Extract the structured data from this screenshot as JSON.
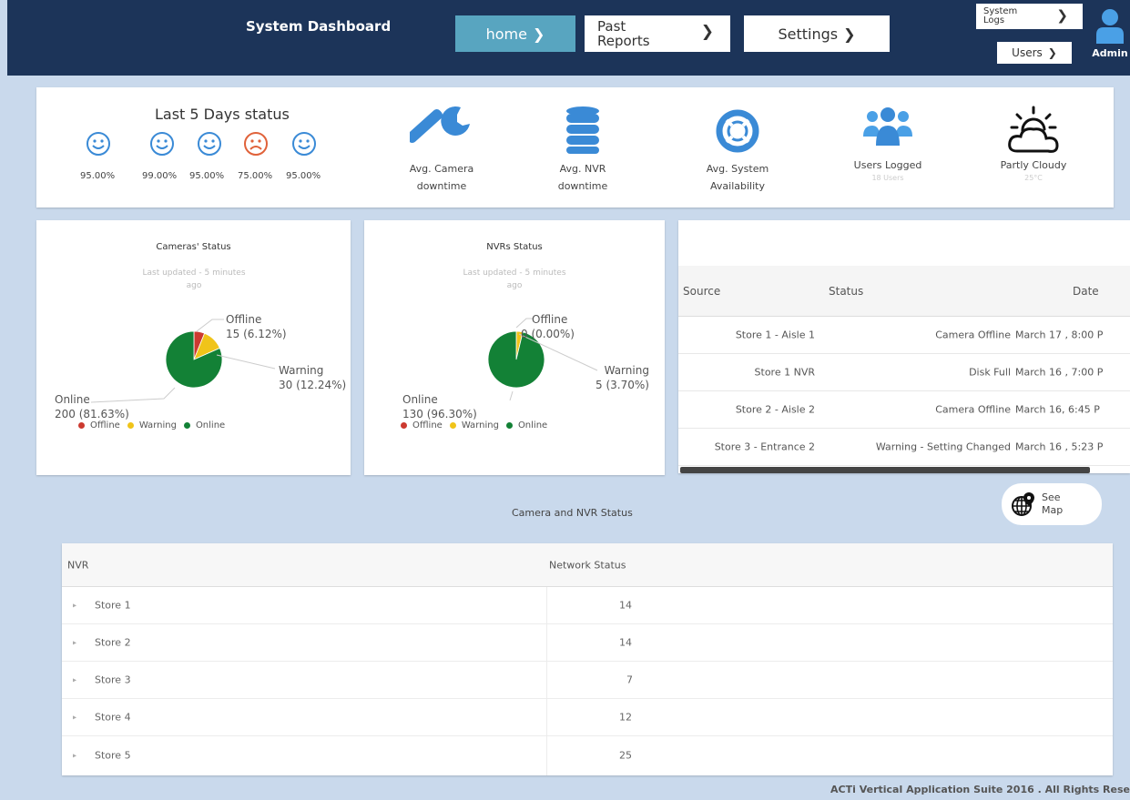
{
  "header": {
    "title": "System Dashboard",
    "nav": {
      "home": "home",
      "past_reports_line1": "Past",
      "past_reports_line2": "Reports",
      "settings": "Settings",
      "system_logs_line1": "System",
      "system_logs_line2": "Logs",
      "users": "Users"
    },
    "user_name": "Admin"
  },
  "status_summary": {
    "last5_title": "Last 5 Days status",
    "days": [
      {
        "percent": "95.00%",
        "mood": "happy"
      },
      {
        "percent": "99.00%",
        "mood": "happy"
      },
      {
        "percent": "95.00%",
        "mood": "happy"
      },
      {
        "percent": "75.00%",
        "mood": "sad"
      },
      {
        "percent": "95.00%",
        "mood": "happy"
      }
    ],
    "stats": [
      {
        "label_line1": "Avg. Camera",
        "label_line2": "downtime",
        "icon": "wrench-icon"
      },
      {
        "label_line1": "Avg. NVR",
        "label_line2": "downtime",
        "icon": "database-icon"
      },
      {
        "label_line1": "Avg. System",
        "label_line2": "Availability",
        "icon": "lifebuoy-icon"
      },
      {
        "label_line1": "Users Logged",
        "label_line2": "18 Users",
        "icon": "users-icon"
      },
      {
        "label_line1": "Partly Cloudy",
        "label_line2": "25°C",
        "icon": "partly-cloudy-icon"
      }
    ]
  },
  "camera_status": {
    "title": "Cameras' Status",
    "updated_line1": "Last updated - 5 minutes",
    "updated_line2": "ago",
    "offline_label": "Offline",
    "offline_value": "15 (6.12%)",
    "warning_label": "Warning",
    "warning_value": "30 (12.24%)",
    "online_label": "Online",
    "online_value": "200 (81.63%)",
    "legend": [
      "Offline",
      "Warning",
      "Online"
    ]
  },
  "nvr_status": {
    "title": "NVRs Status",
    "updated_line1": "Last updated - 5 minutes",
    "updated_line2": "ago",
    "offline_label": "Offline",
    "offline_value": "0 (0.00%)",
    "warning_label": "Warning",
    "warning_value": "5 (3.70%)",
    "online_label": "Online",
    "online_value": "130 (96.30%)",
    "legend": [
      "Offline",
      "Warning",
      "Online"
    ]
  },
  "chart_data": [
    {
      "type": "pie",
      "title": "Cameras' Status",
      "categories": [
        "Offline",
        "Warning",
        "Online"
      ],
      "values": [
        15,
        30,
        200
      ]
    },
    {
      "type": "pie",
      "title": "NVRs Status",
      "categories": [
        "Offline",
        "Warning",
        "Online"
      ],
      "values": [
        0,
        5,
        130
      ]
    }
  ],
  "events": {
    "headers": [
      "Source",
      "Status",
      "Date"
    ],
    "rows": [
      [
        "Store 1 - Aisle 1",
        "Camera Offline",
        "March 17 , 8:00 P"
      ],
      [
        "Store 1 NVR",
        "Disk Full",
        "March 16 , 7:00 P"
      ],
      [
        "Store 2 - Aisle 2",
        "Camera Offline",
        "March 16, 6:45 P"
      ],
      [
        "Store 3 - Entrance 2",
        "Warning - Setting Changed",
        "March 16 , 5:23 P"
      ]
    ]
  },
  "camera_nvr": {
    "title": "Camera and NVR Status",
    "see_map_line1": "See",
    "see_map_line2": "Map",
    "headers": [
      "NVR",
      "Network Status"
    ],
    "rows": [
      [
        "Store 1",
        "14"
      ],
      [
        "Store 2",
        "14"
      ],
      [
        "Store 3",
        "7"
      ],
      [
        "Store 4",
        "12"
      ],
      [
        "Store 5",
        "25"
      ]
    ]
  },
  "footer": "ACTi Vertical Application Suite 2016 . All Rights Rese",
  "colors": {
    "header_bg": "#1c3459",
    "accent": "#58a5c0",
    "icon_blue": "#3a8ad6",
    "offline": "#cc3a30",
    "warning": "#f0c419",
    "online": "#138136"
  }
}
